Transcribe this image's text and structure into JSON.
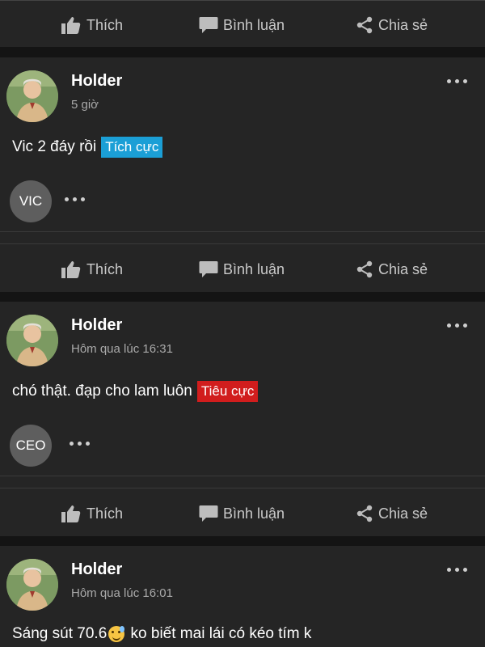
{
  "actions": {
    "like": "Thích",
    "comment": "Bình luận",
    "share": "Chia sẻ"
  },
  "posts": [
    {
      "author": "Holder",
      "time": "5 giờ",
      "text": "Vic 2 đáy rồi",
      "sentiment": {
        "label": "Tích cực",
        "color": "#1b9fd6"
      },
      "tag": "VIC"
    },
    {
      "author": "Holder",
      "time": "Hôm qua lúc 16:31",
      "text": "chó thật. đạp cho lam luôn",
      "sentiment": {
        "label": "Tiêu cực",
        "color": "#d11d1d"
      },
      "tag": "CEO"
    },
    {
      "author": "Holder",
      "time": "Hôm qua lúc 16:01",
      "text_before": "Sáng sút 70.6",
      "emoji": "sweat-smile-emoji",
      "text_after": " ko biết mai lái có kéo tím k"
    }
  ]
}
